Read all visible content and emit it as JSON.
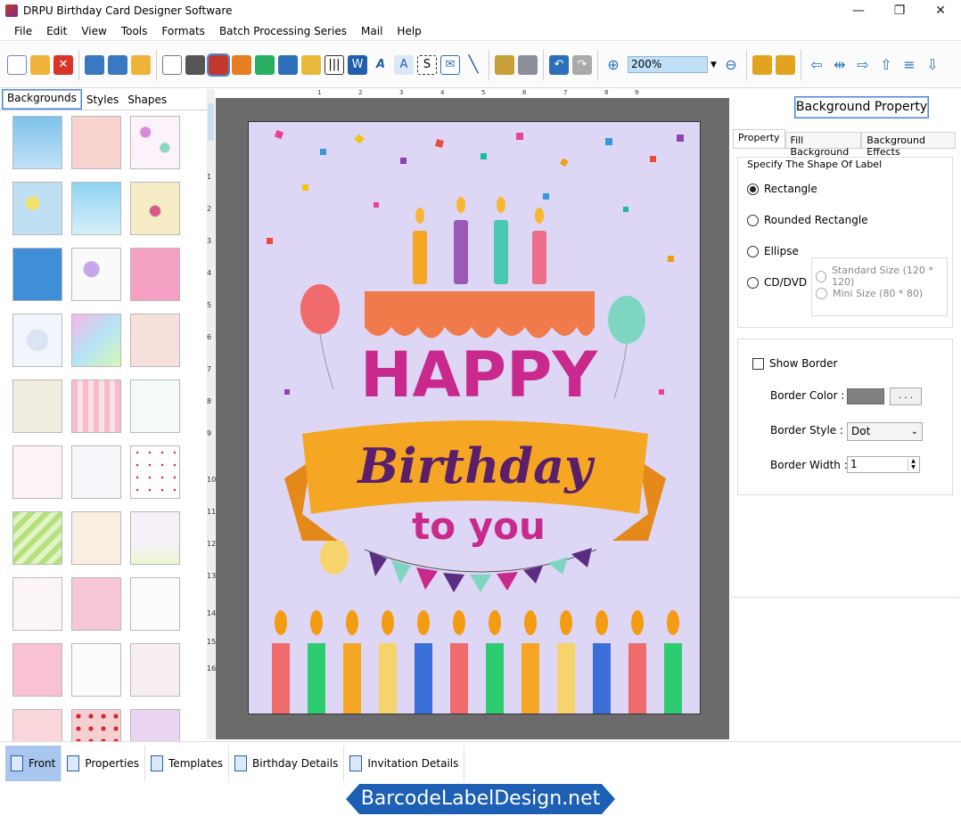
{
  "window": {
    "title": "DRPU Birthday Card Designer Software",
    "minimize": "—",
    "maximize": "❐",
    "close": "✕"
  },
  "menu": [
    "File",
    "Edit",
    "View",
    "Tools",
    "Formats",
    "Batch Processing Series",
    "Mail",
    "Help"
  ],
  "toolbar": {
    "zoom_value": "200%"
  },
  "left_tabs": [
    "Backgrounds",
    "Styles",
    "Shapes"
  ],
  "ruler": {
    "h": [
      "1",
      "2",
      "3",
      "4",
      "5",
      "6",
      "7",
      "8",
      "9"
    ],
    "v": [
      "1",
      "2",
      "3",
      "4",
      "5",
      "6",
      "7",
      "8",
      "9",
      "10",
      "11",
      "12",
      "13",
      "14",
      "15",
      "16"
    ]
  },
  "card": {
    "happy": "HAPPY",
    "birthday": "Birthday",
    "to_you": "to you"
  },
  "right_panel": {
    "header": "Background Property",
    "tabs": [
      "Property",
      "Fill Background",
      "Background Effects"
    ],
    "shape_group_label": "Specify The Shape Of Label",
    "shapes": [
      "Rectangle",
      "Rounded Rectangle",
      "Ellipse",
      "CD/DVD"
    ],
    "selected_shape": "Rectangle",
    "cd_sizes": [
      "Standard Size (120 * 120)",
      "Mini Size (80 * 80)"
    ],
    "show_border": "Show Border",
    "border_color_label": "Border Color :",
    "border_color_btn": ". . .",
    "border_style_label": "Border Style :",
    "border_style_value": "Dot",
    "border_width_label": "Border Width :",
    "border_width_value": "1"
  },
  "bottom_tabs": [
    "Front",
    "Properties",
    "Templates",
    "Birthday Details",
    "Invitation Details"
  ],
  "footer": "BarcodeLabelDesign.net",
  "colors": {
    "accent": "#1c5fb4",
    "card_bg": "#ddd6f5",
    "happy": "#c9298c",
    "birthday": "#5a1f6a",
    "banner": "#f5a623"
  }
}
